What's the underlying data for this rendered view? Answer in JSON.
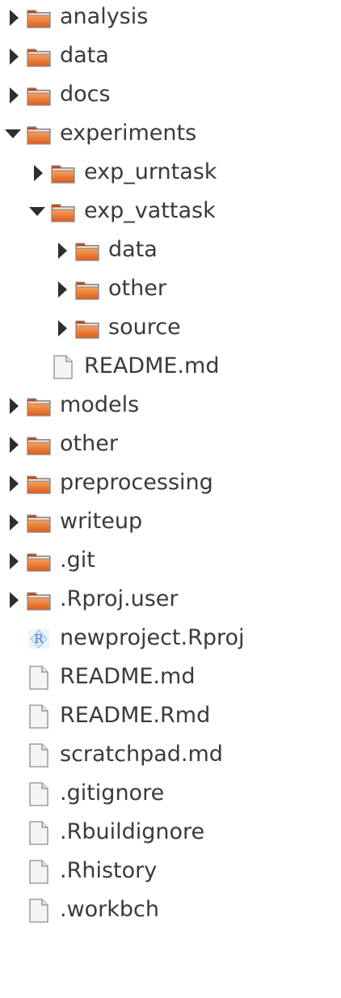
{
  "tree": {
    "items": [
      {
        "label": "analysis",
        "kind": "folder",
        "expanded": false,
        "depth": 0
      },
      {
        "label": "data",
        "kind": "folder",
        "expanded": false,
        "depth": 0
      },
      {
        "label": "docs",
        "kind": "folder",
        "expanded": false,
        "depth": 0
      },
      {
        "label": "experiments",
        "kind": "folder",
        "expanded": true,
        "depth": 0
      },
      {
        "label": "exp_urntask",
        "kind": "folder",
        "expanded": false,
        "depth": 1
      },
      {
        "label": "exp_vattask",
        "kind": "folder",
        "expanded": true,
        "depth": 1
      },
      {
        "label": "data",
        "kind": "folder",
        "expanded": false,
        "depth": 2
      },
      {
        "label": "other",
        "kind": "folder",
        "expanded": false,
        "depth": 2
      },
      {
        "label": "source",
        "kind": "folder",
        "expanded": false,
        "depth": 2
      },
      {
        "label": "README.md",
        "kind": "file",
        "depth": 1
      },
      {
        "label": "models",
        "kind": "folder",
        "expanded": false,
        "depth": 0
      },
      {
        "label": "other",
        "kind": "folder",
        "expanded": false,
        "depth": 0
      },
      {
        "label": "preprocessing",
        "kind": "folder",
        "expanded": false,
        "depth": 0
      },
      {
        "label": "writeup",
        "kind": "folder",
        "expanded": false,
        "depth": 0
      },
      {
        "label": ".git",
        "kind": "folder",
        "expanded": false,
        "depth": 0
      },
      {
        "label": ".Rproj.user",
        "kind": "folder",
        "expanded": false,
        "depth": 0
      },
      {
        "label": "newproject.Rproj",
        "kind": "rproj",
        "depth": 0
      },
      {
        "label": "README.md",
        "kind": "file",
        "depth": 0
      },
      {
        "label": "README.Rmd",
        "kind": "file",
        "depth": 0
      },
      {
        "label": "scratchpad.md",
        "kind": "file",
        "depth": 0
      },
      {
        "label": ".gitignore",
        "kind": "file",
        "depth": 0
      },
      {
        "label": ".Rbuildignore",
        "kind": "file",
        "depth": 0
      },
      {
        "label": ".Rhistory",
        "kind": "file",
        "depth": 0
      },
      {
        "label": ".workbch",
        "kind": "file",
        "depth": 0
      }
    ]
  },
  "colors": {
    "folder_light": "#f4a25c",
    "folder_dark": "#e05a1c",
    "folder_tab": "#c24512",
    "folder_shadow": "#8a8a8a",
    "file_fill": "#f4f4f4",
    "file_stroke": "#8c8c8c",
    "arrow": "#2e2e2e",
    "rproj_blue": "#3d7ac7",
    "text": "#3a3a3a"
  },
  "icons": {
    "folder": "folder-icon",
    "file": "file-icon",
    "rproj": "rproj-icon",
    "collapsed": "chevron-right-icon",
    "expanded": "chevron-down-icon"
  }
}
